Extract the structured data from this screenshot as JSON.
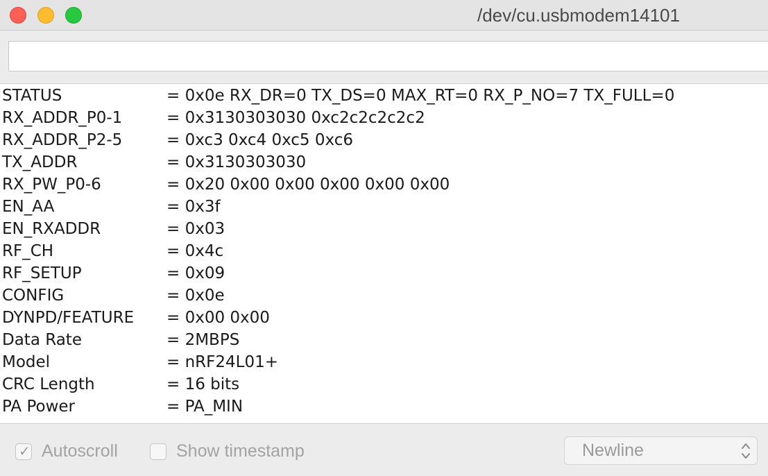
{
  "window": {
    "title": "/dev/cu.usbmodem14101"
  },
  "input": {
    "value": "",
    "placeholder": ""
  },
  "output": {
    "lines": [
      {
        "key": "STATUS",
        "value": "= 0x0e RX_DR=0 TX_DS=0 MAX_RT=0 RX_P_NO=7 TX_FULL=0"
      },
      {
        "key": "RX_ADDR_P0-1",
        "value": "= 0x3130303030 0xc2c2c2c2c2"
      },
      {
        "key": "RX_ADDR_P2-5",
        "value": "= 0xc3 0xc4 0xc5 0xc6"
      },
      {
        "key": "TX_ADDR",
        "value": "= 0x3130303030"
      },
      {
        "key": "RX_PW_P0-6",
        "value": "= 0x20 0x00 0x00 0x00 0x00 0x00"
      },
      {
        "key": "EN_AA",
        "value": "= 0x3f"
      },
      {
        "key": "EN_RXADDR",
        "value": "= 0x03"
      },
      {
        "key": "RF_CH",
        "value": "= 0x4c"
      },
      {
        "key": "RF_SETUP",
        "value": "= 0x09"
      },
      {
        "key": "CONFIG",
        "value": "= 0x0e"
      },
      {
        "key": "DYNPD/FEATURE",
        "value": "= 0x00 0x00"
      },
      {
        "key": "Data Rate",
        "value": "= 2MBPS"
      },
      {
        "key": "Model",
        "value": "= nRF24L01+"
      },
      {
        "key": "CRC Length",
        "value": "= 16 bits"
      },
      {
        "key": "PA Power",
        "value": "= PA_MIN"
      }
    ]
  },
  "footer": {
    "autoscroll": {
      "label": "Autoscroll",
      "checked": true
    },
    "timestamp": {
      "label": "Show timestamp",
      "checked": false
    },
    "line_ending": {
      "selected": "Newline"
    }
  },
  "colors": {
    "close": "#fe5f57",
    "minimize": "#febc2e",
    "zoom": "#28c840"
  },
  "icons": {
    "checkmark": "check-icon",
    "select_arrows": "chevron-up-down-icon"
  }
}
